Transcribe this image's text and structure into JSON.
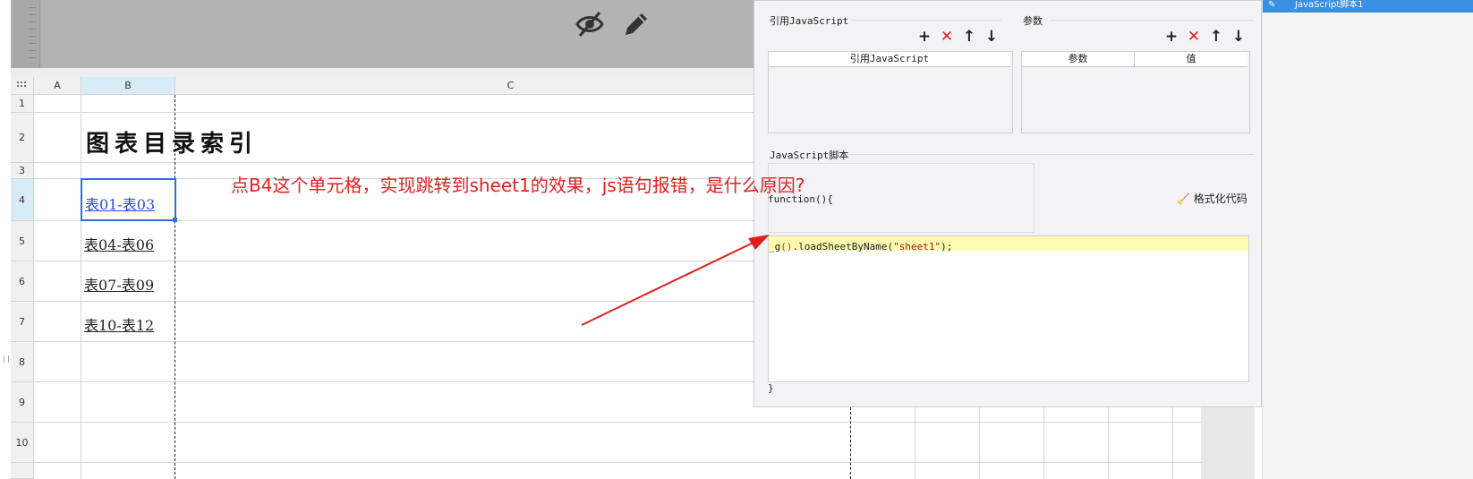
{
  "spreadsheet": {
    "columns": [
      "A",
      "B",
      "C"
    ],
    "rows": [
      "1",
      "2",
      "3",
      "4",
      "5",
      "6",
      "7",
      "8",
      "9",
      "10"
    ],
    "title": "图表目录索引",
    "links": [
      "表01-表03",
      "表04-表06",
      "表07-表09",
      "表10-表12"
    ]
  },
  "annotation": {
    "text": "点B4这个单元格，实现跳转到sheet1的效果，js语句报错，是什么原因?",
    "color": "#e02020"
  },
  "toolbar_icons": [
    "eye-off-icon",
    "pencil-icon"
  ],
  "right_sidebar": {
    "item": "JavaScript脚本1"
  },
  "panel": {
    "ref_js": {
      "title": "引用JavaScript",
      "column": "引用JavaScript"
    },
    "params": {
      "title": "参数",
      "columns": [
        "参数",
        "值"
      ]
    },
    "tools": [
      "+",
      "✕",
      "↑",
      "↓"
    ],
    "script": {
      "title": "JavaScript脚本",
      "header": "function(){",
      "format_button": "格式化代码",
      "code_prefix": "_g",
      "code_paren": "()",
      "code_middle": ".loadSheetByName(",
      "code_string": "\"sheet1\"",
      "code_end": ");",
      "footer": "}"
    }
  },
  "colors": {
    "accent": "#3b8fe0",
    "selection": "#2f6fd6",
    "annotation": "#e02020"
  }
}
